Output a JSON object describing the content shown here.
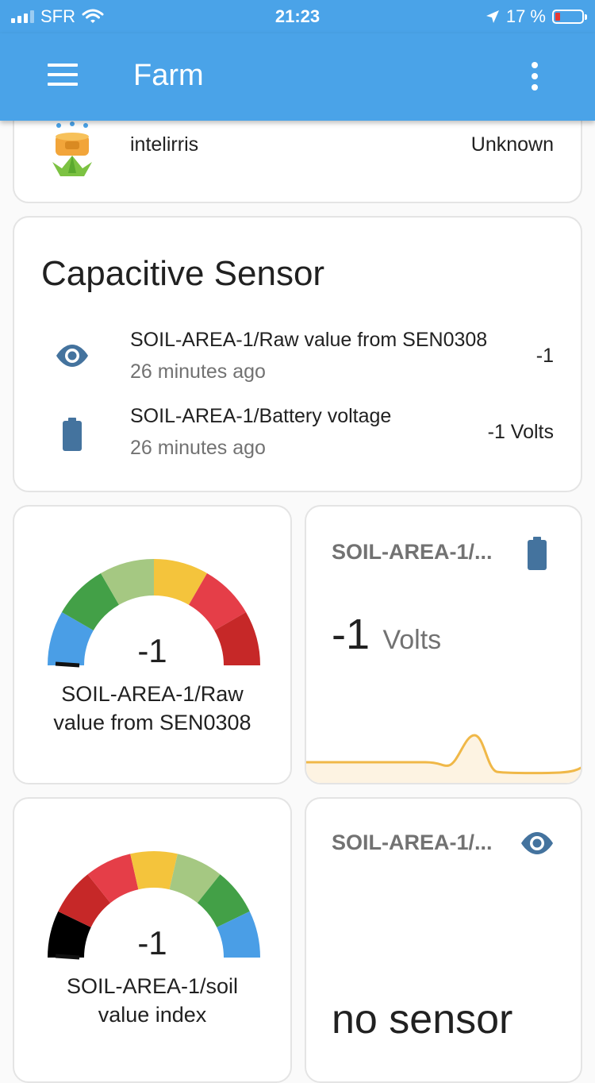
{
  "status_bar": {
    "carrier": "SFR",
    "time": "21:23",
    "battery_percent": "17 %"
  },
  "app_bar": {
    "title": "Farm",
    "menu_icon": "hamburger-menu-icon",
    "more_icon": "more-vertical-icon"
  },
  "intelirris_card": {
    "name": "intelirris",
    "state": "Unknown",
    "icon": "watering-plant-icon"
  },
  "capacitive_card": {
    "title": "Capacitive Sensor",
    "rows": [
      {
        "icon": "eye-icon",
        "name": "SOIL-AREA-1/Raw value from SEN0308",
        "time": "26 minutes ago",
        "value": "-1"
      },
      {
        "icon": "battery-icon",
        "name": "SOIL-AREA-1/Battery voltage",
        "time": "26 minutes ago",
        "value": "-1 Volts"
      }
    ]
  },
  "gauge_raw": {
    "value": "-1",
    "value_fraction": 0,
    "label_line1": "SOIL-AREA-1/Raw",
    "label_line2": "value from SEN0308",
    "segment_colors": [
      "#4a9ee6",
      "#43a047",
      "#a5c882",
      "#f4c43c",
      "#e53e48",
      "#c62828"
    ]
  },
  "battery_sensor_card": {
    "title": "SOIL-AREA-1/...",
    "icon": "battery-icon",
    "value": "-1",
    "unit": "Volts",
    "line_color": "#f0b848"
  },
  "gauge_index": {
    "value": "-1",
    "value_fraction": 0,
    "label_line1": "SOIL-AREA-1/soil",
    "label_line2": "value index",
    "segment_colors": [
      "#000000",
      "#c62828",
      "#e53e48",
      "#f4c43c",
      "#a5c882",
      "#43a047",
      "#4a9ee6"
    ]
  },
  "raw_sensor_card": {
    "title": "SOIL-AREA-1/...",
    "icon": "eye-icon",
    "state": "no sensor"
  },
  "colors": {
    "primary": "#4aa3e8",
    "icon_blue": "#44739e",
    "card_border": "#e4e4e4"
  }
}
